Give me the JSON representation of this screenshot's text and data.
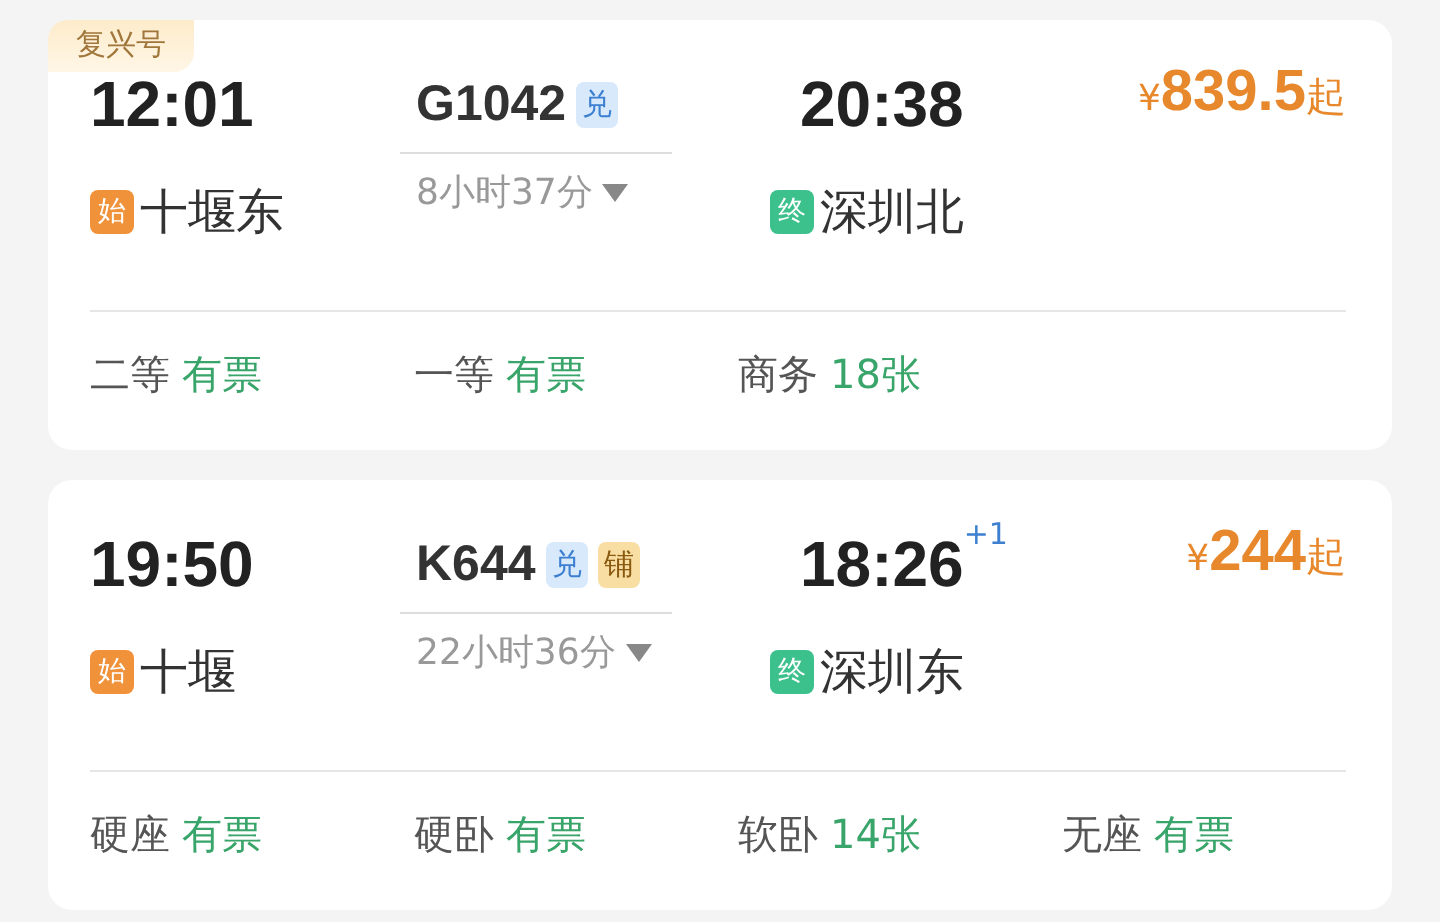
{
  "trains": [
    {
      "tag": "复兴号",
      "depart": {
        "time": "12:01",
        "station": "十堰东",
        "badge": "始",
        "kind": "start"
      },
      "train_no": "G1042",
      "train_badges": [
        {
          "text": "兑",
          "kind": "exchange"
        }
      ],
      "duration": "8小时37分",
      "arrive": {
        "time": "20:38",
        "station": "深圳北",
        "badge": "终",
        "kind": "end"
      },
      "price": {
        "currency": "¥",
        "amount": "839.5",
        "suffix": "起"
      },
      "seats": [
        {
          "class": "二等",
          "availability": "有票"
        },
        {
          "class": "一等",
          "availability": "有票"
        },
        {
          "class": "商务",
          "availability": "18张"
        }
      ]
    },
    {
      "depart": {
        "time": "19:50",
        "station": "十堰",
        "badge": "始",
        "kind": "start"
      },
      "train_no": "K644",
      "train_badges": [
        {
          "text": "兑",
          "kind": "exchange"
        },
        {
          "text": "铺",
          "kind": "berth"
        }
      ],
      "duration": "22小时36分",
      "arrive": {
        "time": "18:26",
        "day_offset": "+1",
        "station": "深圳东",
        "badge": "终",
        "kind": "end"
      },
      "price": {
        "currency": "¥",
        "amount": "244",
        "suffix": "起"
      },
      "seats": [
        {
          "class": "硬座",
          "availability": "有票"
        },
        {
          "class": "硬卧",
          "availability": "有票"
        },
        {
          "class": "软卧",
          "availability": "14张"
        },
        {
          "class": "无座",
          "availability": "有票"
        }
      ]
    }
  ]
}
